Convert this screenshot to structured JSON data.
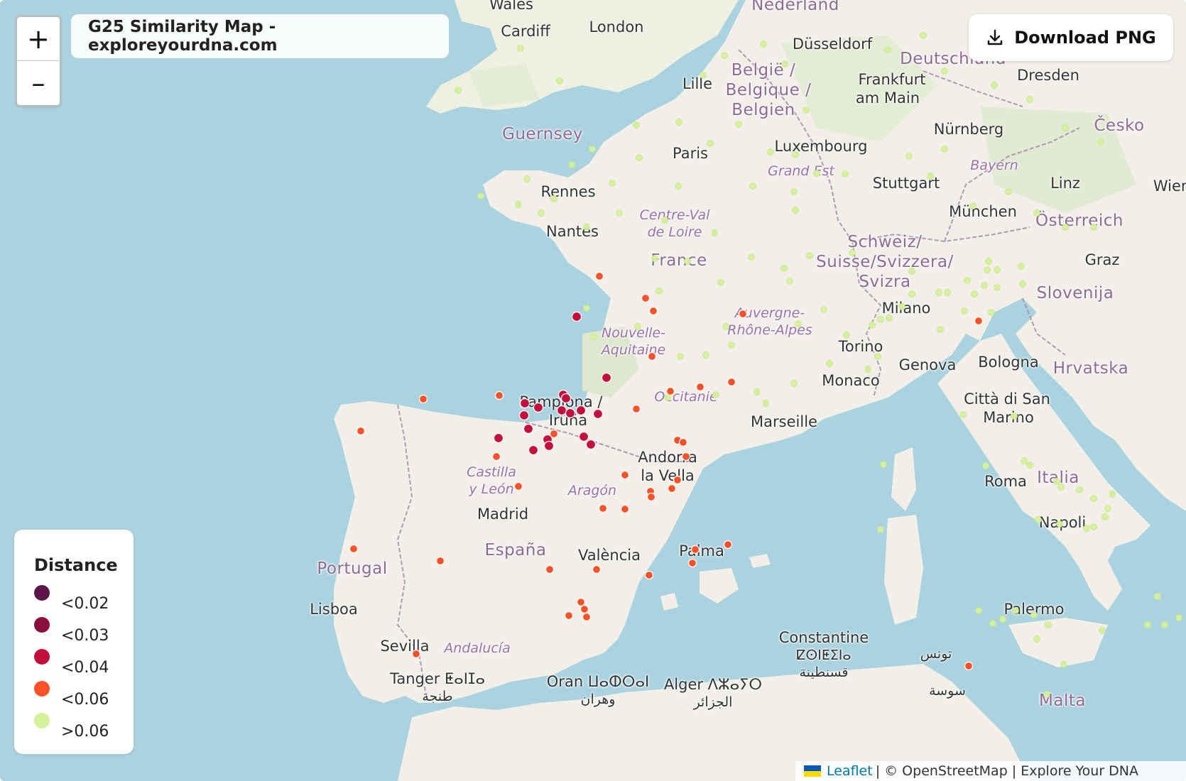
{
  "map": {
    "title": "G25 Similarity Map - exploreyourdna.com",
    "zoom_in_label": "+",
    "zoom_out_label": "–",
    "download_label": "Download PNG",
    "attribution": {
      "leaflet": "Leaflet",
      "rest": "| © OpenStreetMap | Explore Your DNA"
    },
    "colors": {
      "sea": "#abd3df",
      "land": "#f2efe9",
      "border": "#a889a8"
    }
  },
  "legend": {
    "title": "Distance",
    "items": [
      {
        "label": "<0.02",
        "color": "#5c1547"
      },
      {
        "label": "<0.03",
        "color": "#8a0f3f"
      },
      {
        "label": "<0.04",
        "color": "#c40e3c"
      },
      {
        "label": "<0.06",
        "color": "#ff5127"
      },
      {
        "label": ">0.06",
        "color": "#d4f29a"
      }
    ]
  },
  "places": {
    "cardiff": "Cardiff",
    "london": "London",
    "wales": "Wales",
    "nederland": "Nederland",
    "dusseldorf": "Düsseldorf",
    "belgie1": "België /",
    "belgie2": "Belgique /",
    "belgie3": "Belgien",
    "lille": "Lille",
    "frankfurt1": "Frankfurt",
    "frankfurt2": "am Main",
    "deutschland": "Deutschland",
    "dresden": "Dresden",
    "guernsey": "Guernsey",
    "paris": "Paris",
    "luxembourg": "Luxembourg",
    "grandest": "Grand Est",
    "nurnberg": "Nürnberg",
    "cesko": "Česko",
    "bayern": "Bayern",
    "stuttgart": "Stuttgart",
    "linz": "Linz",
    "wien": "Wien",
    "rennes": "Rennes",
    "nantes": "Nantes",
    "centre1": "Centre-Val",
    "centre2": "de Loire",
    "munchen": "München",
    "osterreich": "Österreich",
    "schweiz1": "Schweiz/",
    "schweiz2": "Suisse/Svizzera/",
    "schweiz3": "Svizra",
    "france": "France",
    "graz": "Graz",
    "slovenija": "Slovenija",
    "milano": "Milano",
    "auvergne1": "Auvergne-",
    "auvergne2": "Rhône-Alpes",
    "nouvelle1": "Nouvelle-",
    "nouvelle2": "Aquitaine",
    "torino": "Torino",
    "genova": "Genova",
    "bologna": "Bologna",
    "hrvatska": "Hrvatska",
    "monaco": "Monaco",
    "occitanie": "Occitanie",
    "pamplona1": "Pamplona /",
    "pamplona2": "Iruña",
    "sanmarino1": "Città di San",
    "sanmarino2": "Marino",
    "marseille": "Marseille",
    "andorra1": "Andorra",
    "andorra2": "la Vella",
    "castilla1": "Castilla",
    "castilla2": "y León",
    "aragon": "Aragón",
    "roma": "Roma",
    "italia": "Italia",
    "madrid": "Madrid",
    "espana": "España",
    "valencia": "València",
    "palma": "Palma",
    "napoli": "Napoli",
    "portugal": "Portugal",
    "lisboa": "Lisboa",
    "palermo": "Palermo",
    "sevilla": "Sevilla",
    "andalucia": "Andalucía",
    "constantine1": "Constantine",
    "constantine2": "ⵇⵙⵏⵟⵉⵏⴰ",
    "constantine3": "قسنطينة",
    "tanger1": "Tanger ⵟⴰⵏⵊⴰ",
    "tanger2": "طنجة",
    "oran1": "Oran ⵡⴰⵀⵔⴰⵏ",
    "oran2": "وهران",
    "alger1": "Alger ⴷⵣⴰⵢⵔ",
    "alger2": "الجزائر",
    "tunis": "تونس",
    "sousse": "سوسة",
    "malta": "Malta"
  }
}
